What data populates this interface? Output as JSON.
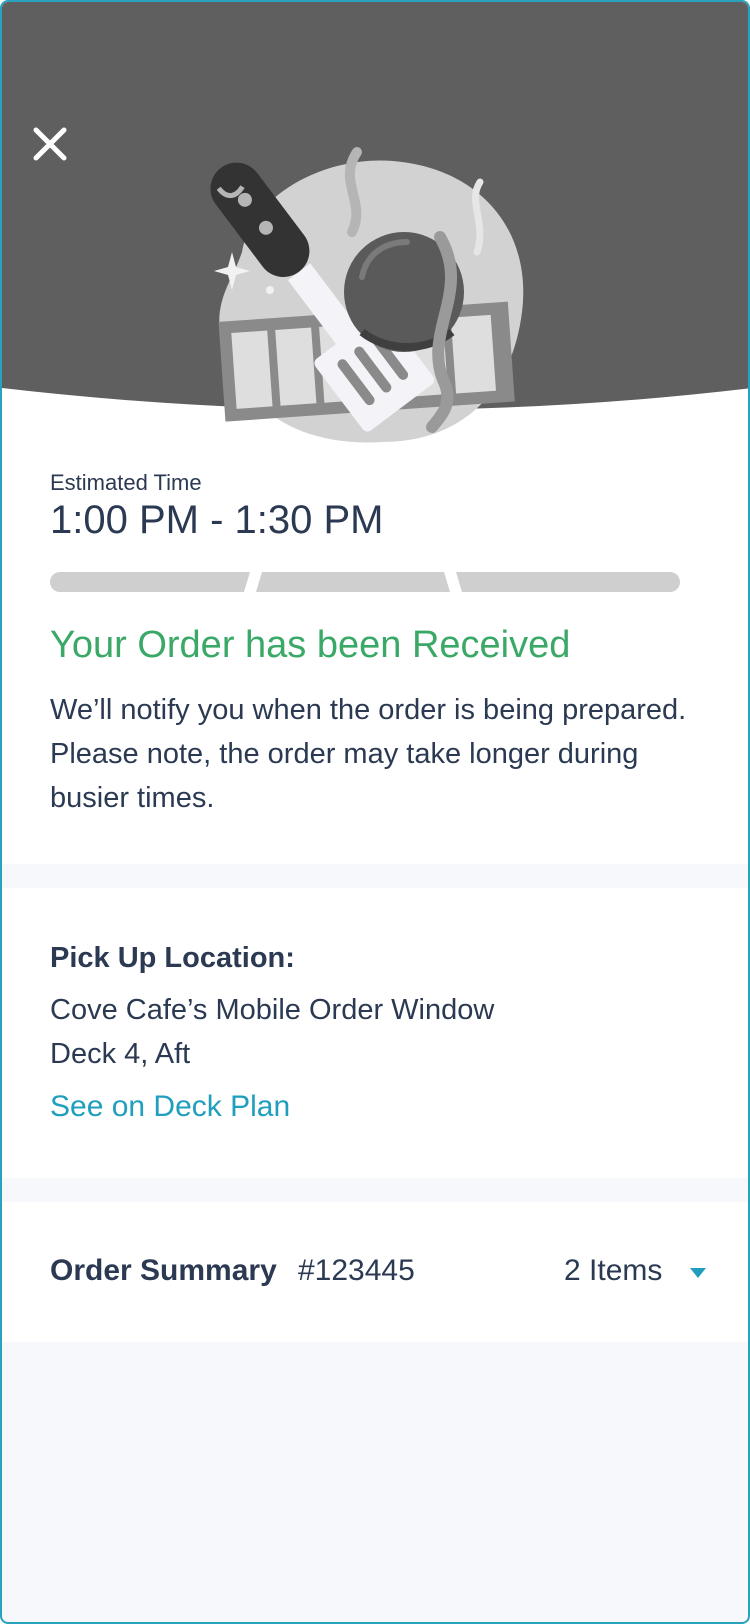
{
  "hero": {
    "close_icon": "close-icon",
    "illustration": "spatula-grill-illustration"
  },
  "estimate": {
    "label": "Estimated Time",
    "value": "1:00 PM - 1:30 PM",
    "progress_steps": 3,
    "progress_completed": 0
  },
  "status": {
    "title": "Your Order has been Received",
    "description": "We’ll notify you when the order is being prepared. Please note, the order may take longer during busier times."
  },
  "pickup": {
    "label": "Pick Up Location:",
    "line1": "Cove Cafe’s Mobile Order Window",
    "line2": "Deck 4, Aft",
    "link": "See on Deck Plan"
  },
  "summary": {
    "label": "Order Summary",
    "number": "#123445",
    "items": "2 Items",
    "chevron_icon": "caret-down-icon"
  },
  "colors": {
    "header_bg": "#5f5f5f",
    "success": "#3aa866",
    "link": "#1f9fbd",
    "text": "#2b3a52",
    "progress_empty": "#cfcfcf",
    "page_bg": "#f6f8fb",
    "frame_border": "#29a3bd"
  }
}
